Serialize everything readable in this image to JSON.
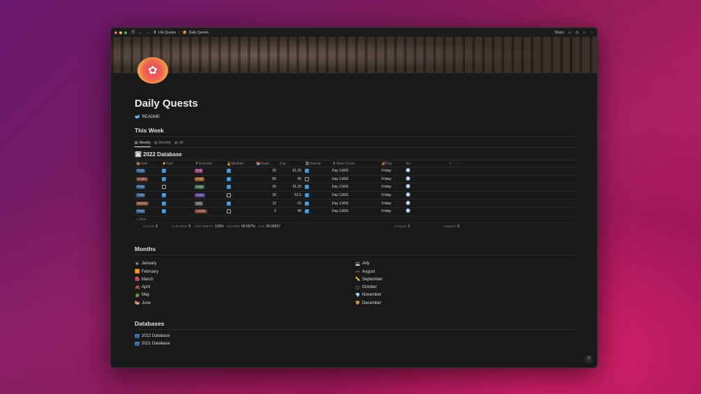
{
  "titlebar": {
    "breadcrumbs": [
      {
        "icon": "X",
        "label": "Life Quests"
      },
      {
        "icon": "🍤",
        "label": "Daily Quests"
      }
    ],
    "share_label": "Share",
    "icons": [
      "sidebar-menu-icon",
      "back-arrow-icon",
      "forward-arrow-icon",
      "comment-icon",
      "history-icon",
      "star-icon",
      "more-icon"
    ]
  },
  "page": {
    "title": "Daily Quests",
    "readme": {
      "icon": "🥣",
      "label": "README"
    }
  },
  "week": {
    "heading": "This Week",
    "tabs": [
      {
        "icon": "▤",
        "label": "Weekly"
      },
      {
        "icon": "▤",
        "label": "Monthly"
      },
      {
        "icon": "▤",
        "label": "All"
      }
    ],
    "database_title": "2022 Database",
    "database_icon": "🗓",
    "columns": [
      "🍩Junk ...",
      "⚡Fast",
      "🏃Exercise",
      "🧘Meditati...",
      "📚Read...",
      "Exp",
      "📓Journal",
      "🏃Alive Count",
      "🎉Day",
      "Aa",
      "+",
      "···"
    ],
    "column_icons": [
      "list",
      "check",
      "list",
      "check",
      "list",
      "sigma",
      "check",
      "sigma",
      "sigma",
      "text"
    ],
    "rows": [
      {
        "junk": "Free",
        "junk_color": "#2d5a8a",
        "fast": true,
        "exercise": "Pull",
        "exercise_color": "#8a3a6a",
        "meditation": true,
        "read": "25",
        "exp": "61.25",
        "journal": true,
        "alive": "Day 11691",
        "day": "Friday"
      },
      {
        "junk": "Snaks",
        "junk_color": "#7a3a2a",
        "fast": true,
        "exercise": "Push",
        "exercise_color": "#8a5a1a",
        "meditation": true,
        "read": "80",
        "exp": "55",
        "journal": false,
        "alive": "Day 11691",
        "day": "Friday"
      },
      {
        "junk": "Free",
        "junk_color": "#2d5a8a",
        "fast": false,
        "exercise": "Legs",
        "exercise_color": "#3a6a4a",
        "meditation": true,
        "read": "25",
        "exp": "51.25",
        "journal": true,
        "alive": "Day 11691",
        "day": "Friday"
      },
      {
        "junk": "Free",
        "junk_color": "#2d5a8a",
        "fast": true,
        "exercise": "Arms",
        "exercise_color": "#5a3a8a",
        "meditation": false,
        "read": "30",
        "exp": "52.5",
        "journal": true,
        "alive": "Day 11691",
        "day": "Friday"
      },
      {
        "junk": "Dinner",
        "junk_color": "#7a4a2a",
        "fast": true,
        "exercise": "Abs",
        "exercise_color": "#5a5a5a",
        "meditation": true,
        "read": "12",
        "exp": "-10",
        "journal": true,
        "alive": "Day 11691",
        "day": "Friday"
      },
      {
        "junk": "Free",
        "junk_color": "#2d5a8a",
        "fast": true,
        "exercise": "Cardio",
        "exercise_color": "#7a3a2a",
        "meditation": false,
        "read": "0",
        "exp": "40",
        "journal": true,
        "alive": "Day 11691",
        "day": "Friday"
      }
    ],
    "new_label": "+ New",
    "calc": {
      "count_label": "COUNT",
      "count_value": "6",
      "checked_label": "CHECKED",
      "checked_value": "5",
      "notempty_label": "NOT EMPTY",
      "notempty_value": "100%",
      "checked2_label": "HECKED",
      "checked2_value": "66.667%",
      "avg_label": "AVG",
      "avg_value": "28.66667",
      "unique1_label": "UNIQUE",
      "unique1_value": "1",
      "unique2_label": "UNIQUE",
      "unique2_value": "0"
    }
  },
  "months": {
    "heading": "Months",
    "left": [
      {
        "icon": "❄",
        "label": "January"
      },
      {
        "icon": "🟧",
        "label": "February"
      },
      {
        "icon": "🌺",
        "label": "March"
      },
      {
        "icon": "🍂",
        "label": "April"
      },
      {
        "icon": "🪴",
        "label": "May"
      },
      {
        "icon": "🍉",
        "label": "June"
      }
    ],
    "right": [
      {
        "icon": "💻",
        "label": "July"
      },
      {
        "icon": "〰",
        "label": "August"
      },
      {
        "icon": "📏",
        "label": "September"
      },
      {
        "icon": "◻",
        "label": "October"
      },
      {
        "icon": "💎",
        "label": "November"
      },
      {
        "icon": "🦁",
        "label": "December"
      }
    ]
  },
  "databases": {
    "heading": "Databases",
    "items": [
      "2022 Database",
      "2021 Database"
    ]
  },
  "help_label": "?"
}
